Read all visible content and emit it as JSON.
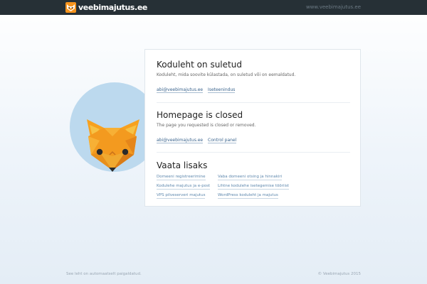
{
  "header": {
    "logo_text": "veebimajutus.ee",
    "site_link": "www.veebimajutus.ee"
  },
  "card": {
    "estonian": {
      "title": "Koduleht on suletud",
      "description": "Koduleht, mida soovite külastada, on suletud või on eemaldatud.",
      "links": [
        "abi@veebimajutus.ee",
        "Iseteenindus"
      ]
    },
    "english": {
      "title": "Homepage is closed",
      "description": "The page you requested is closed or removed.",
      "links": [
        "abi@veebimajutus.ee",
        "Control panel"
      ]
    },
    "see_also": {
      "title": "Vaata lisaks",
      "links": [
        "Domeeni registreerimine",
        "Vaba domeeni otsing ja hinnakiri",
        "Kodulehe majutus ja e-post",
        "Lihtne kodulehe isetegemise tööriist",
        "VPS pilveserveri majutus",
        "WordPress koduleht ja majutus"
      ]
    }
  },
  "footer": {
    "left": "See leht on automaatselt paigaldatud.",
    "right": "© Veebimajutus 2015"
  },
  "colors": {
    "topbar": "#263036",
    "fox_orange": "#f39a1f",
    "circle": "#bcd9ee",
    "link": "#38628c"
  }
}
